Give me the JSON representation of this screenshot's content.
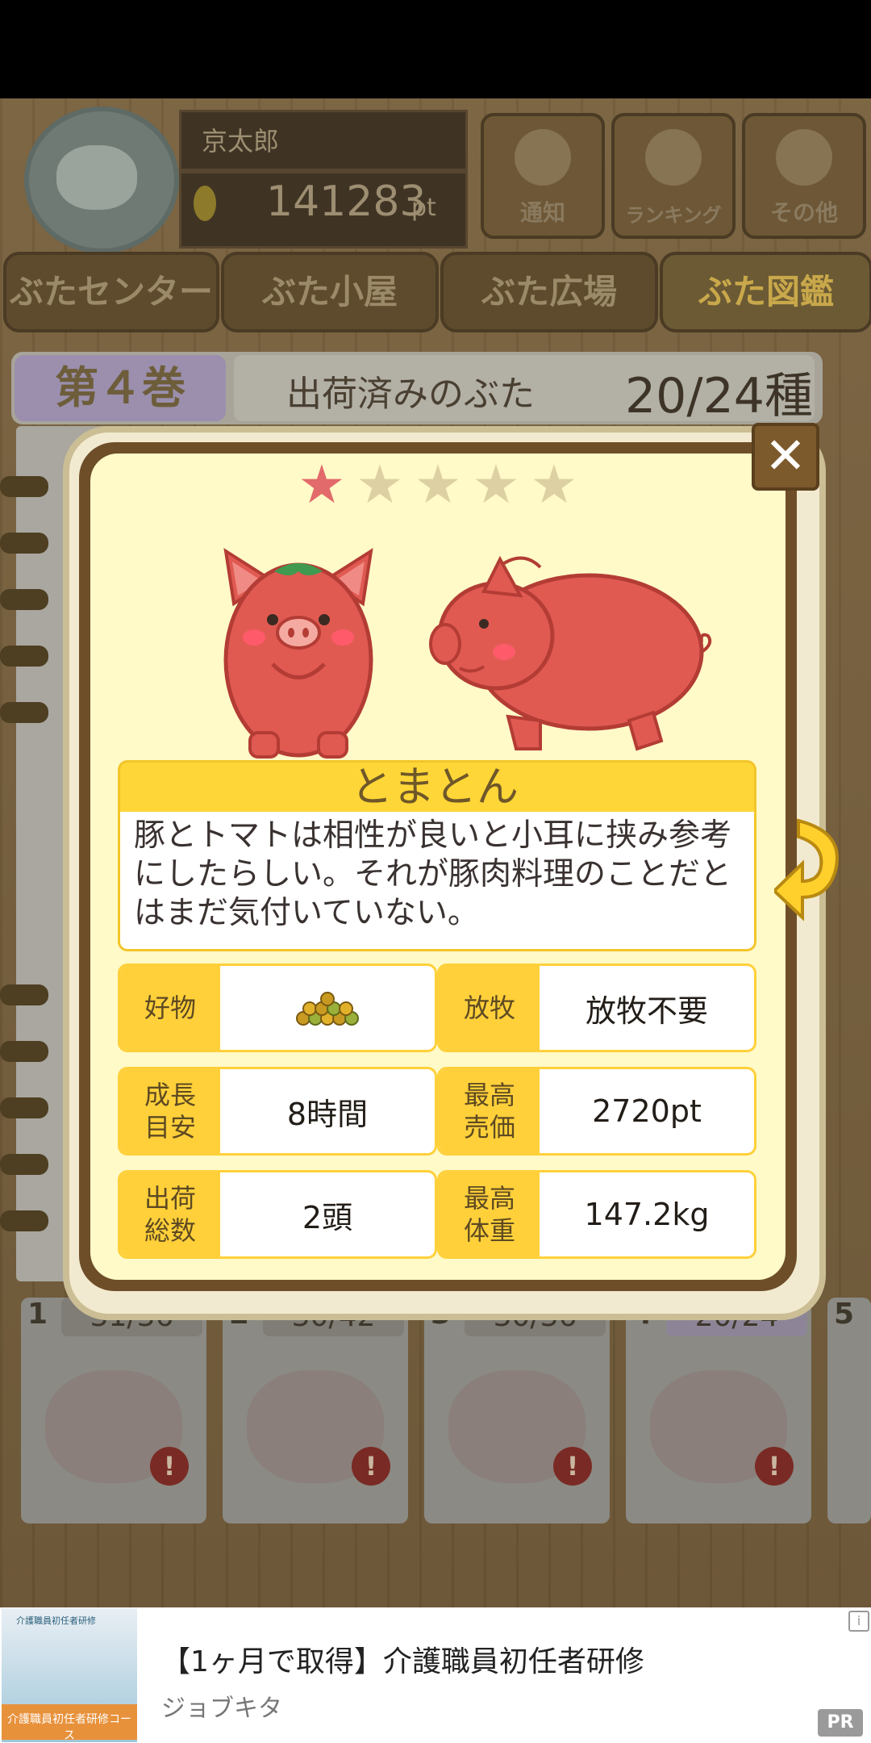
{
  "header": {
    "player_name": "京太郎",
    "points": "141283",
    "points_unit": "pt",
    "buttons": [
      {
        "label": "通知",
        "icon": "bell-icon"
      },
      {
        "label": "ランキング",
        "icon": "crown-icon"
      },
      {
        "label": "その他",
        "icon": "gear-icon"
      }
    ]
  },
  "tabs": [
    {
      "label": "ぶたセンター"
    },
    {
      "label": "ぶた小屋"
    },
    {
      "label": "ぶた広場"
    },
    {
      "label": "ぶた図鑑"
    }
  ],
  "book": {
    "volume": "第４巻",
    "shipped_label": "出荷済みのぶた",
    "shipped_count": "20/24種"
  },
  "volumes": [
    {
      "num": "1",
      "count": "31/36"
    },
    {
      "num": "2",
      "count": "30/42"
    },
    {
      "num": "3",
      "count": "30/36"
    },
    {
      "num": "4",
      "count": "20/24"
    },
    {
      "num": "5",
      "count": ""
    }
  ],
  "modal": {
    "close_symbol": "✕",
    "stars_filled": 1,
    "stars_total": 5,
    "pig_name": "とまとん",
    "description": "豚とトマトは相性が良いと小耳に挟み参考にしたらしい。それが豚肉料理のことだとはまだ気付いていない。",
    "stats": [
      {
        "label": "好物",
        "value": "",
        "icon": "grain-pile-icon"
      },
      {
        "label": "放牧",
        "value": "放牧不要"
      },
      {
        "label": "成長\n目安",
        "value": "8時間"
      },
      {
        "label": "最高\n売価",
        "value": "2720pt"
      },
      {
        "label": "出荷\n総数",
        "value": "2頭"
      },
      {
        "label": "最高\n体重",
        "value": "147.2kg"
      }
    ]
  },
  "ad": {
    "title": "【1ヶ月で取得】介護職員初任者研修",
    "source": "ジョブキタ",
    "badge": "PR",
    "info": "i",
    "image_band_text": "介護職員初任者研修コース",
    "image_caption": "介護職員初任者研修"
  },
  "colors": {
    "pig_red": "#e05a52",
    "banner_yellow": "#fed637",
    "modal_bg": "#fffac8",
    "frame_brown": "#6e4e28"
  }
}
